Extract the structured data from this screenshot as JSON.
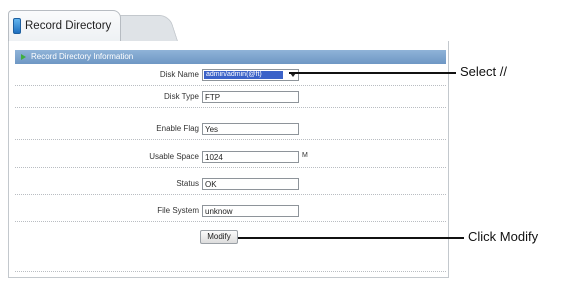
{
  "tab": {
    "label": "Record Directory"
  },
  "section": {
    "title": "Record Directory Information"
  },
  "form": {
    "disk_name": {
      "label": "Disk Name",
      "value": "admin/admin(@ft)"
    },
    "disk_type": {
      "label": "Disk Type",
      "value": "FTP"
    },
    "enable_flag": {
      "label": "Enable Flag",
      "value": "Yes"
    },
    "usable_space": {
      "label": "Usable Space",
      "value": "1024",
      "unit": "M"
    },
    "status": {
      "label": "Status",
      "value": "OK"
    },
    "file_system": {
      "label": "File System",
      "value": "unknow"
    },
    "modify_label": "Modify"
  },
  "callouts": {
    "select": "Select //",
    "modify": "Click Modify"
  },
  "colors": {
    "header_bg": "#7aa3cf",
    "selection_bg": "#3b62c8",
    "tab_icon": "#2f87d6"
  }
}
